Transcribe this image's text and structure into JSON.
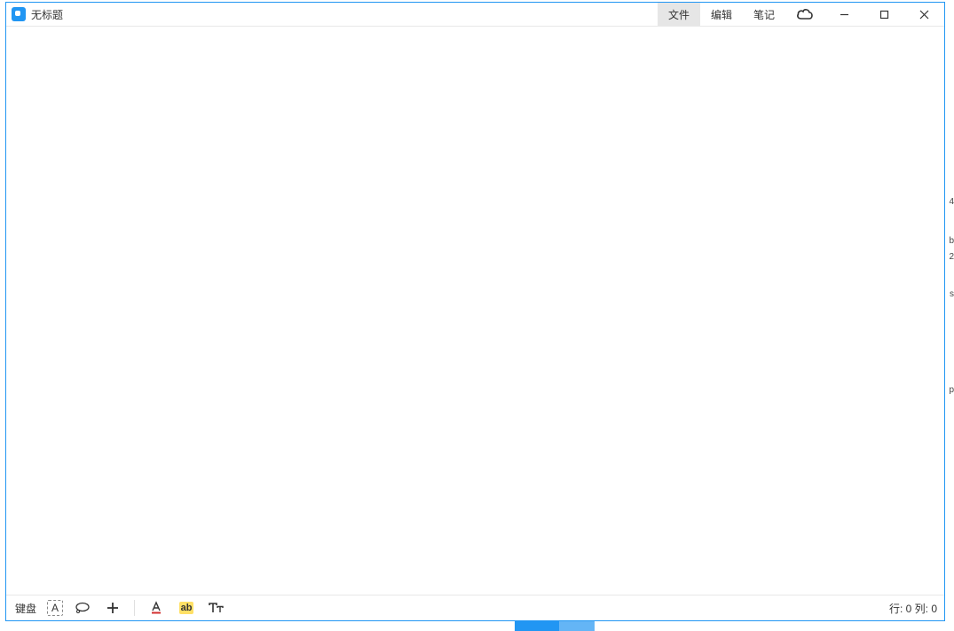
{
  "window": {
    "title": "无标题"
  },
  "menu": {
    "file": "文件",
    "edit": "编辑",
    "notes": "笔记"
  },
  "bottombar": {
    "keyboard": "键盘",
    "text_tool_letter": "A",
    "highlight_label": "ab",
    "status": "行: 0 列: 0"
  },
  "bg_hints": {
    "h1": "4",
    "h2": "b",
    "h3": "2",
    "h4": "s",
    "h5": "p"
  }
}
